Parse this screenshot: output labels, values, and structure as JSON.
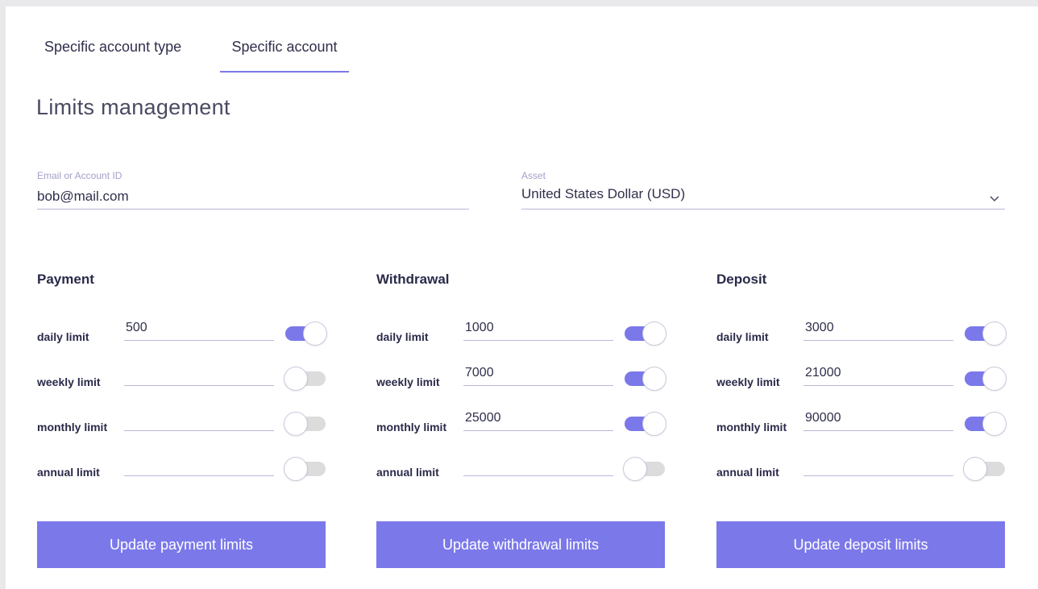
{
  "tabs": [
    {
      "label": "Specific account type",
      "active": false
    },
    {
      "label": "Specific account",
      "active": true
    }
  ],
  "page_title": "Limits management",
  "email_field": {
    "label": "Email or Account ID",
    "value": "bob@mail.com"
  },
  "asset_field": {
    "label": "Asset",
    "value": "United States Dollar (USD)",
    "icon": "chevron-down-icon"
  },
  "sections": [
    {
      "title": "Payment",
      "rows": [
        {
          "label": "daily limit",
          "value": "500",
          "enabled": true
        },
        {
          "label": "weekly limit",
          "value": "",
          "enabled": false
        },
        {
          "label": "monthly limit",
          "value": "",
          "enabled": false
        },
        {
          "label": "annual limit",
          "value": "",
          "enabled": false
        }
      ],
      "button": "Update payment limits"
    },
    {
      "title": "Withdrawal",
      "rows": [
        {
          "label": "daily limit",
          "value": "1000",
          "enabled": true
        },
        {
          "label": "weekly limit",
          "value": "7000",
          "enabled": true
        },
        {
          "label": "monthly limit",
          "value": "25000",
          "enabled": true
        },
        {
          "label": "annual limit",
          "value": "",
          "enabled": false
        }
      ],
      "button": "Update withdrawal limits"
    },
    {
      "title": "Deposit",
      "rows": [
        {
          "label": "daily limit",
          "value": "3000",
          "enabled": true
        },
        {
          "label": "weekly limit",
          "value": "21000",
          "enabled": true
        },
        {
          "label": "monthly limit",
          "value": "90000",
          "enabled": true
        },
        {
          "label": "annual limit",
          "value": "",
          "enabled": false
        }
      ],
      "button": "Update deposit limits"
    }
  ],
  "colors": {
    "accent": "#7b78ea",
    "toggle_off": "#dcdcdc",
    "text": "#2f2f4c",
    "muted_label": "#a2a2c9"
  }
}
